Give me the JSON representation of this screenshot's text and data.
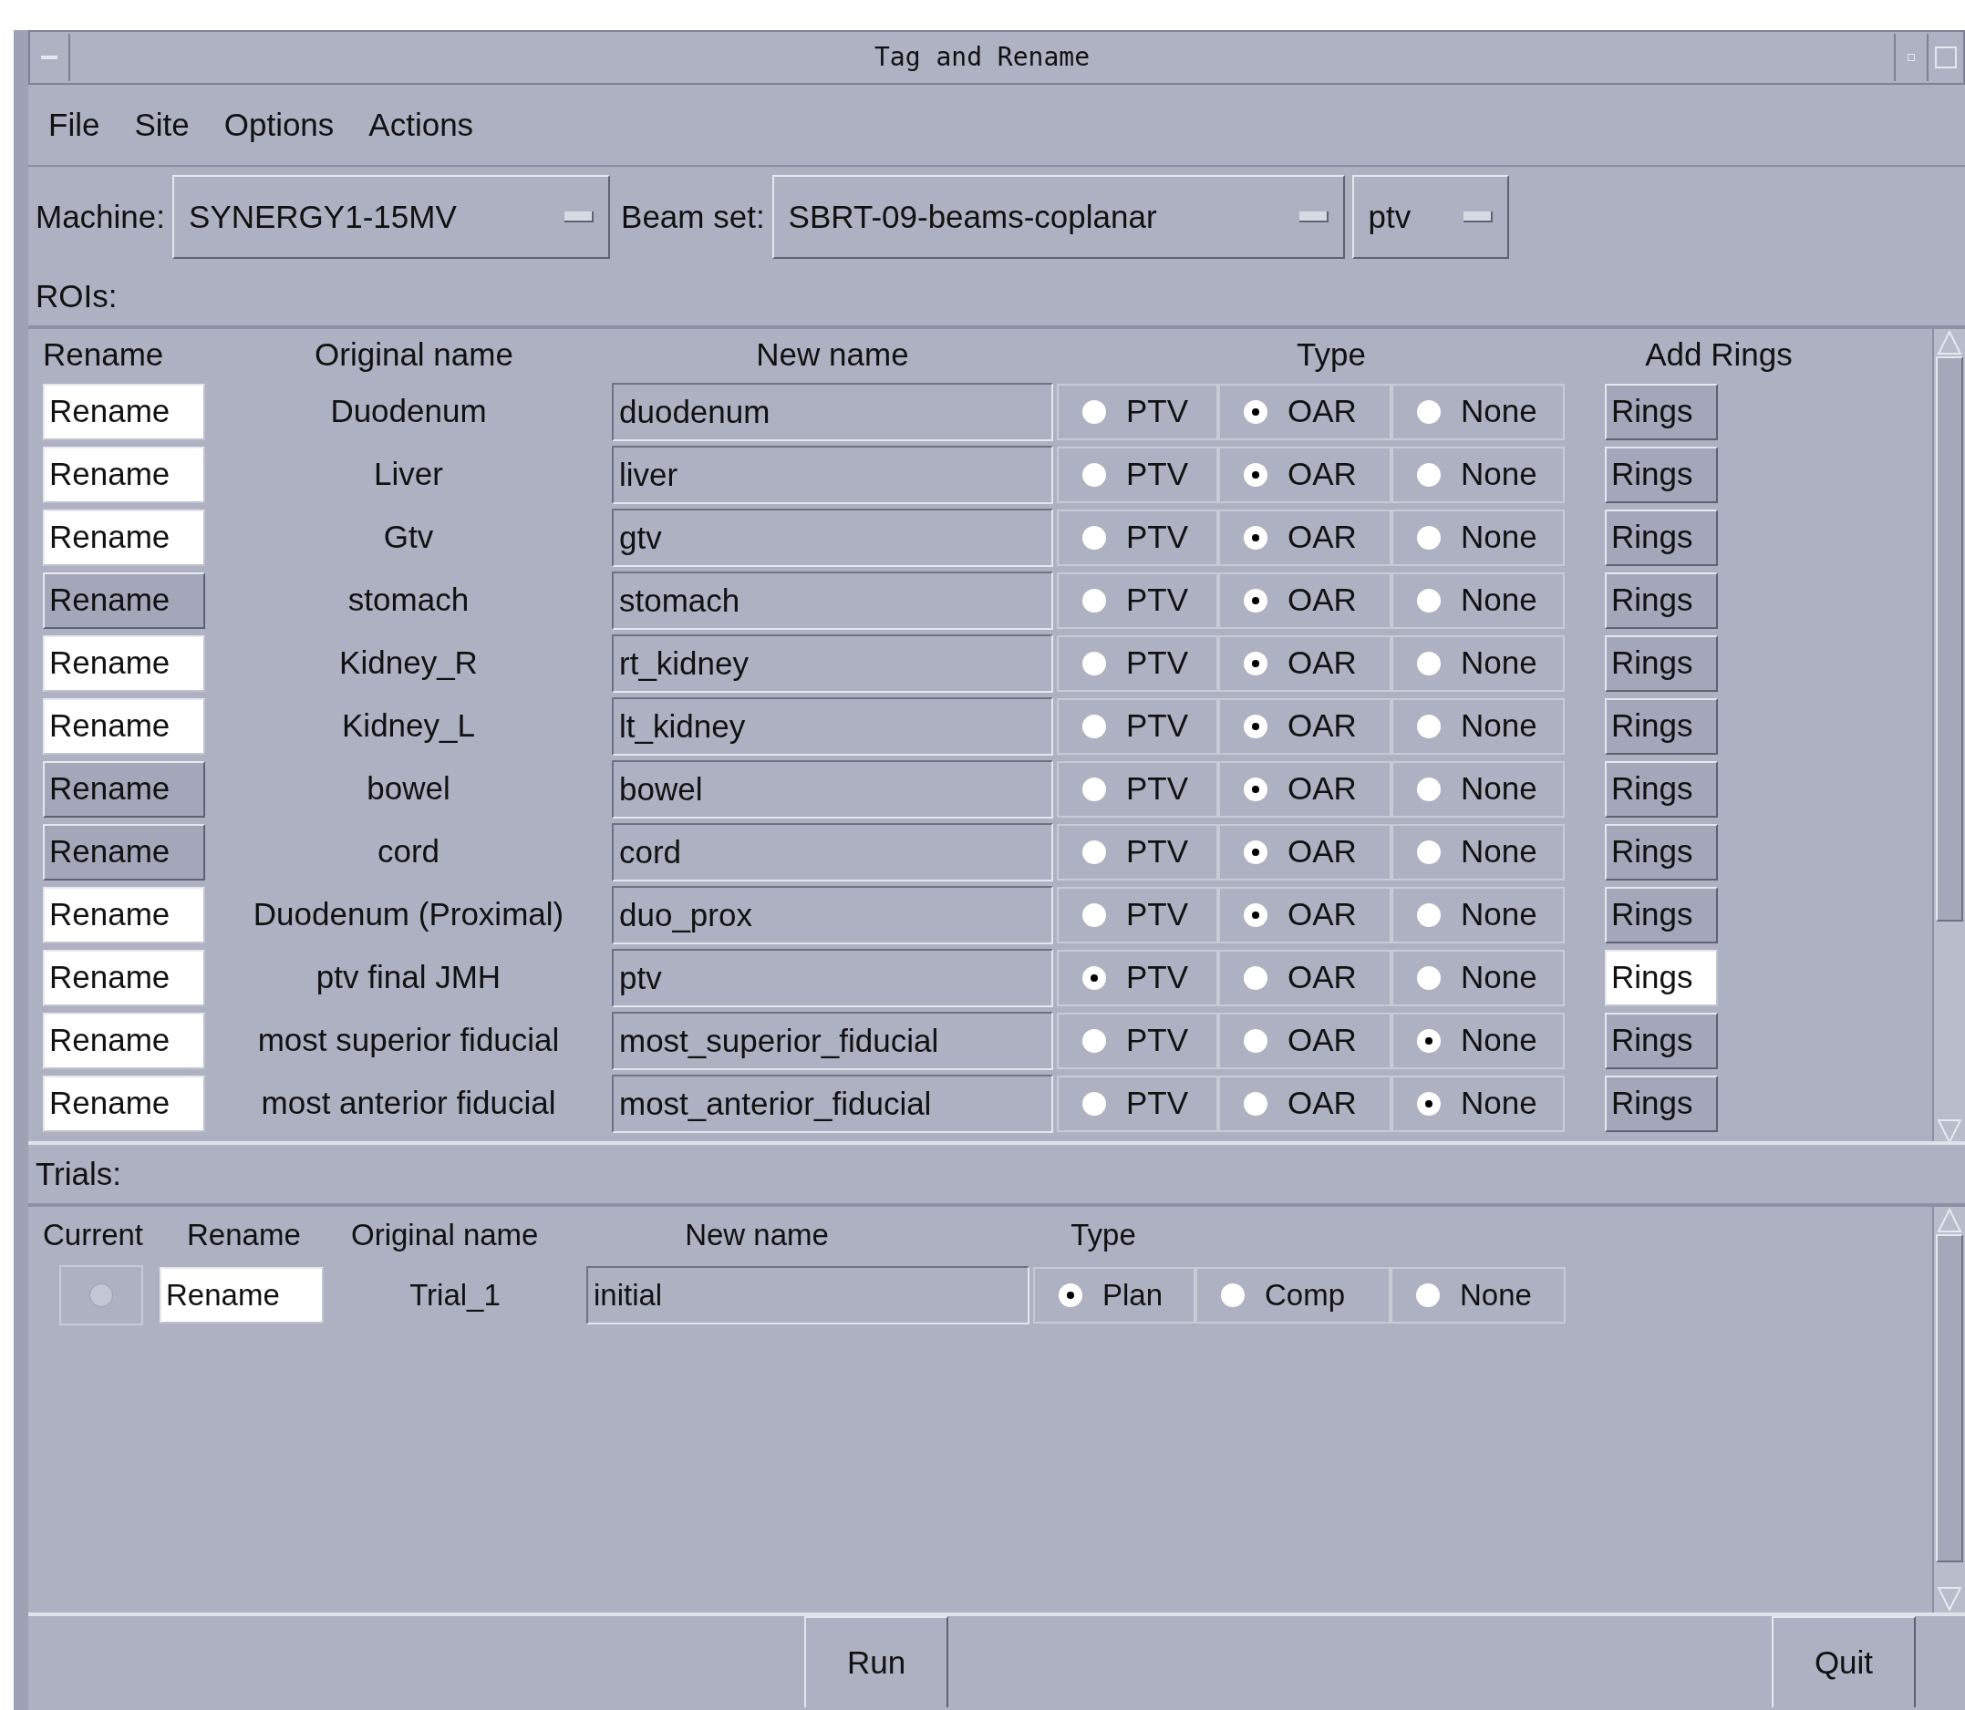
{
  "window": {
    "title": "Tag and Rename"
  },
  "menu": [
    "File",
    "Site",
    "Options",
    "Actions"
  ],
  "machine": {
    "label": "Machine:",
    "value": "SYNERGY1-15MV"
  },
  "beam_set": {
    "label": "Beam set:",
    "value": "SBRT-09-beams-coplanar"
  },
  "beam_target": {
    "value": "ptv"
  },
  "rois": {
    "label": "ROIs:",
    "columns": [
      "Rename",
      "Original name",
      "New name",
      "Type",
      "Add Rings"
    ],
    "rows": [
      {
        "rename": "Rename",
        "rename_on": true,
        "original": "Duodenum",
        "new_name": "duodenum",
        "types": [
          {
            "label": "PTV",
            "selected": false
          },
          {
            "label": "OAR",
            "selected": true
          },
          {
            "label": "None",
            "selected": false
          }
        ],
        "rings": "Rings",
        "rings_on": false
      },
      {
        "rename": "Rename",
        "rename_on": true,
        "original": "Liver",
        "new_name": "liver",
        "types": [
          {
            "label": "PTV",
            "selected": false
          },
          {
            "label": "OAR",
            "selected": true
          },
          {
            "label": "None",
            "selected": false
          }
        ],
        "rings": "Rings",
        "rings_on": false
      },
      {
        "rename": "Rename",
        "rename_on": true,
        "original": "Gtv",
        "new_name": "gtv",
        "types": [
          {
            "label": "PTV",
            "selected": false
          },
          {
            "label": "OAR",
            "selected": true
          },
          {
            "label": "None",
            "selected": false
          }
        ],
        "rings": "Rings",
        "rings_on": false
      },
      {
        "rename": "Rename",
        "rename_on": false,
        "original": "stomach",
        "new_name": "stomach",
        "types": [
          {
            "label": "PTV",
            "selected": false
          },
          {
            "label": "OAR",
            "selected": true
          },
          {
            "label": "None",
            "selected": false
          }
        ],
        "rings": "Rings",
        "rings_on": false
      },
      {
        "rename": "Rename",
        "rename_on": true,
        "original": "Kidney_R",
        "new_name": "rt_kidney",
        "types": [
          {
            "label": "PTV",
            "selected": false
          },
          {
            "label": "OAR",
            "selected": true
          },
          {
            "label": "None",
            "selected": false
          }
        ],
        "rings": "Rings",
        "rings_on": false
      },
      {
        "rename": "Rename",
        "rename_on": true,
        "original": "Kidney_L",
        "new_name": "lt_kidney",
        "types": [
          {
            "label": "PTV",
            "selected": false
          },
          {
            "label": "OAR",
            "selected": true
          },
          {
            "label": "None",
            "selected": false
          }
        ],
        "rings": "Rings",
        "rings_on": false
      },
      {
        "rename": "Rename",
        "rename_on": false,
        "original": "bowel",
        "new_name": "bowel",
        "types": [
          {
            "label": "PTV",
            "selected": false
          },
          {
            "label": "OAR",
            "selected": true
          },
          {
            "label": "None",
            "selected": false
          }
        ],
        "rings": "Rings",
        "rings_on": false
      },
      {
        "rename": "Rename",
        "rename_on": false,
        "original": "cord",
        "new_name": "cord",
        "types": [
          {
            "label": "PTV",
            "selected": false
          },
          {
            "label": "OAR",
            "selected": true
          },
          {
            "label": "None",
            "selected": false
          }
        ],
        "rings": "Rings",
        "rings_on": false
      },
      {
        "rename": "Rename",
        "rename_on": true,
        "original": "Duodenum (Proximal)",
        "new_name": "duo_prox",
        "types": [
          {
            "label": "PTV",
            "selected": false
          },
          {
            "label": "OAR",
            "selected": true
          },
          {
            "label": "None",
            "selected": false
          }
        ],
        "rings": "Rings",
        "rings_on": false
      },
      {
        "rename": "Rename",
        "rename_on": true,
        "original": "ptv final JMH",
        "new_name": "ptv",
        "types": [
          {
            "label": "PTV",
            "selected": true
          },
          {
            "label": "OAR",
            "selected": false
          },
          {
            "label": "None",
            "selected": false
          }
        ],
        "rings": "Rings",
        "rings_on": true
      },
      {
        "rename": "Rename",
        "rename_on": true,
        "original": "most superior fiducial",
        "new_name": "most_superior_fiducial",
        "types": [
          {
            "label": "PTV",
            "selected": false
          },
          {
            "label": "OAR",
            "selected": false
          },
          {
            "label": "None",
            "selected": true
          }
        ],
        "rings": "Rings",
        "rings_on": false
      },
      {
        "rename": "Rename",
        "rename_on": true,
        "original": "most anterior fiducial",
        "new_name": "most_anterior_fiducial",
        "types": [
          {
            "label": "PTV",
            "selected": false
          },
          {
            "label": "OAR",
            "selected": false
          },
          {
            "label": "None",
            "selected": true
          }
        ],
        "rings": "Rings",
        "rings_on": false
      }
    ]
  },
  "trials": {
    "label": "Trials:",
    "columns": [
      "Current",
      "Rename",
      "Original name",
      "New name",
      "Type"
    ],
    "rows": [
      {
        "current_disabled": true,
        "rename": "Rename",
        "rename_on": true,
        "original": "Trial_1",
        "new_name": "initial",
        "types": [
          {
            "label": "Plan",
            "selected": true
          },
          {
            "label": "Comp",
            "selected": false
          },
          {
            "label": "None",
            "selected": false
          }
        ]
      }
    ]
  },
  "buttons": [
    "Run",
    "Quit"
  ]
}
